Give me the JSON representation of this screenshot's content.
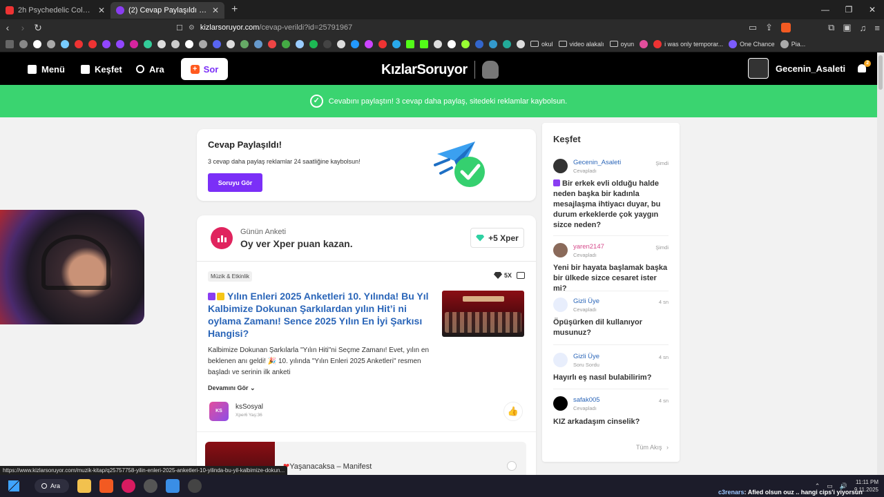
{
  "browser": {
    "tabs": [
      {
        "title": "2h Psychedelic Colorful Neon Backgr",
        "fav_color": "#e33"
      },
      {
        "title": "(2) Cevap Paylaşıldı - KizlarSoruyo",
        "fav_color": "#8a3df2"
      }
    ],
    "url_host": "kizlarsoruyor.com",
    "url_path": "/cevap-verildi?id=25791967",
    "bookmarks": {
      "folders": [
        "okul",
        "video alakalı",
        "oyun"
      ],
      "links": [
        "i was only temporar...",
        "One Chance",
        "Pia..."
      ]
    }
  },
  "header": {
    "menu_label": "Menü",
    "explore_label": "Keşfet",
    "search_label": "Ara",
    "ask_label": "Sor",
    "logo_text": "KızlarSoruyor",
    "username": "Gecenin_Asaleti",
    "notif_count": "2"
  },
  "banner": {
    "text": "Cevabını paylaştın! 3 cevap daha paylaş, sitedeki reklamlar kaybolsun."
  },
  "shared_card": {
    "title": "Cevap Paylaşıldı!",
    "text": "3 cevap daha paylaş reklamlar 24 saatliğine kaybolsun!",
    "button": "Soruyu Gör"
  },
  "poll": {
    "subtitle": "Günün Anketi",
    "title": "Oy ver Xper puan kazan.",
    "xper_badge": "+5 Xper",
    "category": "Müzik & Etkinlik",
    "multiplier": "5X",
    "question_title": "Yılın Enleri 2025 Anketleri 10. Yılında! Bu Yıl Kalbimize Dokunan Şarkılardan yılın Hit’i ni oylama Zamanı! Sence 2025 Yılın En İyi Şarkısı Hangisi?",
    "question_text": "Kalbimize Dokunan Şarkılarla \"Yılın Hiti\"ni Seçme Zamanı! Evet, yılın en beklenen anı geldi! 🎉 10. yılında \"Yılın Enleri 2025 Anketleri\" resmen başladı ve serinin ilk anketi",
    "more_label": "Devamını Gör",
    "author": "ksSosyal",
    "author_avatar_text": "KS SOSYAL",
    "author_meta": "Xper6 Yaş:36",
    "option_label": "Yaşanacaksa – Manifest"
  },
  "sidebar": {
    "title": "Keşfet",
    "items": [
      {
        "user": "Gecenin_Asaleti",
        "status": "Cevapladı",
        "time": "Şimdi",
        "question": "Bir erkek evli olduğu halde neden başka bir kadınla mesajlaşma ihtiyacı duyar, bu durum erkeklerde çok yaygın sizce neden?"
      },
      {
        "user": "yaren2147",
        "status": "Cevapladı",
        "time": "Şimdi",
        "question": "Yeni bir hayata başlamak başka bir ülkede sizce cesaret ister mi?"
      },
      {
        "user": "Gizli Üye",
        "status": "Cevapladı",
        "time": "4 sn",
        "question": "Öpüşürken dil kullanıyor musunuz?"
      },
      {
        "user": "Gizli Üye",
        "status": "Soru Sordu",
        "time": "4 sn",
        "question": "Hayırlı eş nasıl bulabilirim?"
      },
      {
        "user": "safak005",
        "status": "Cevapladı",
        "time": "4 sn",
        "question": "KIZ arkadaşım cinselik?"
      }
    ],
    "all_flow": "Tüm Akış"
  },
  "status_url": "https://www.kizlarsoruyor.com/muzik-kitap/q25757758-yilin-enleri-2025-anketleri-10-yilinda-bu-yil-kalbimize-dokun...",
  "taskbar": {
    "search_label": "Ara",
    "time": "11:11 PM",
    "date": "9.11.2025",
    "chat_user": "c3renars",
    "chat_text": ": Afied olsun ouz .. hangi cips'i yiyorsun"
  },
  "colors": {
    "accent_purple": "#7b2ff7",
    "banner_green": "#3ad470",
    "link_blue": "#2a65b8",
    "poll_pink": "#e0245e"
  }
}
